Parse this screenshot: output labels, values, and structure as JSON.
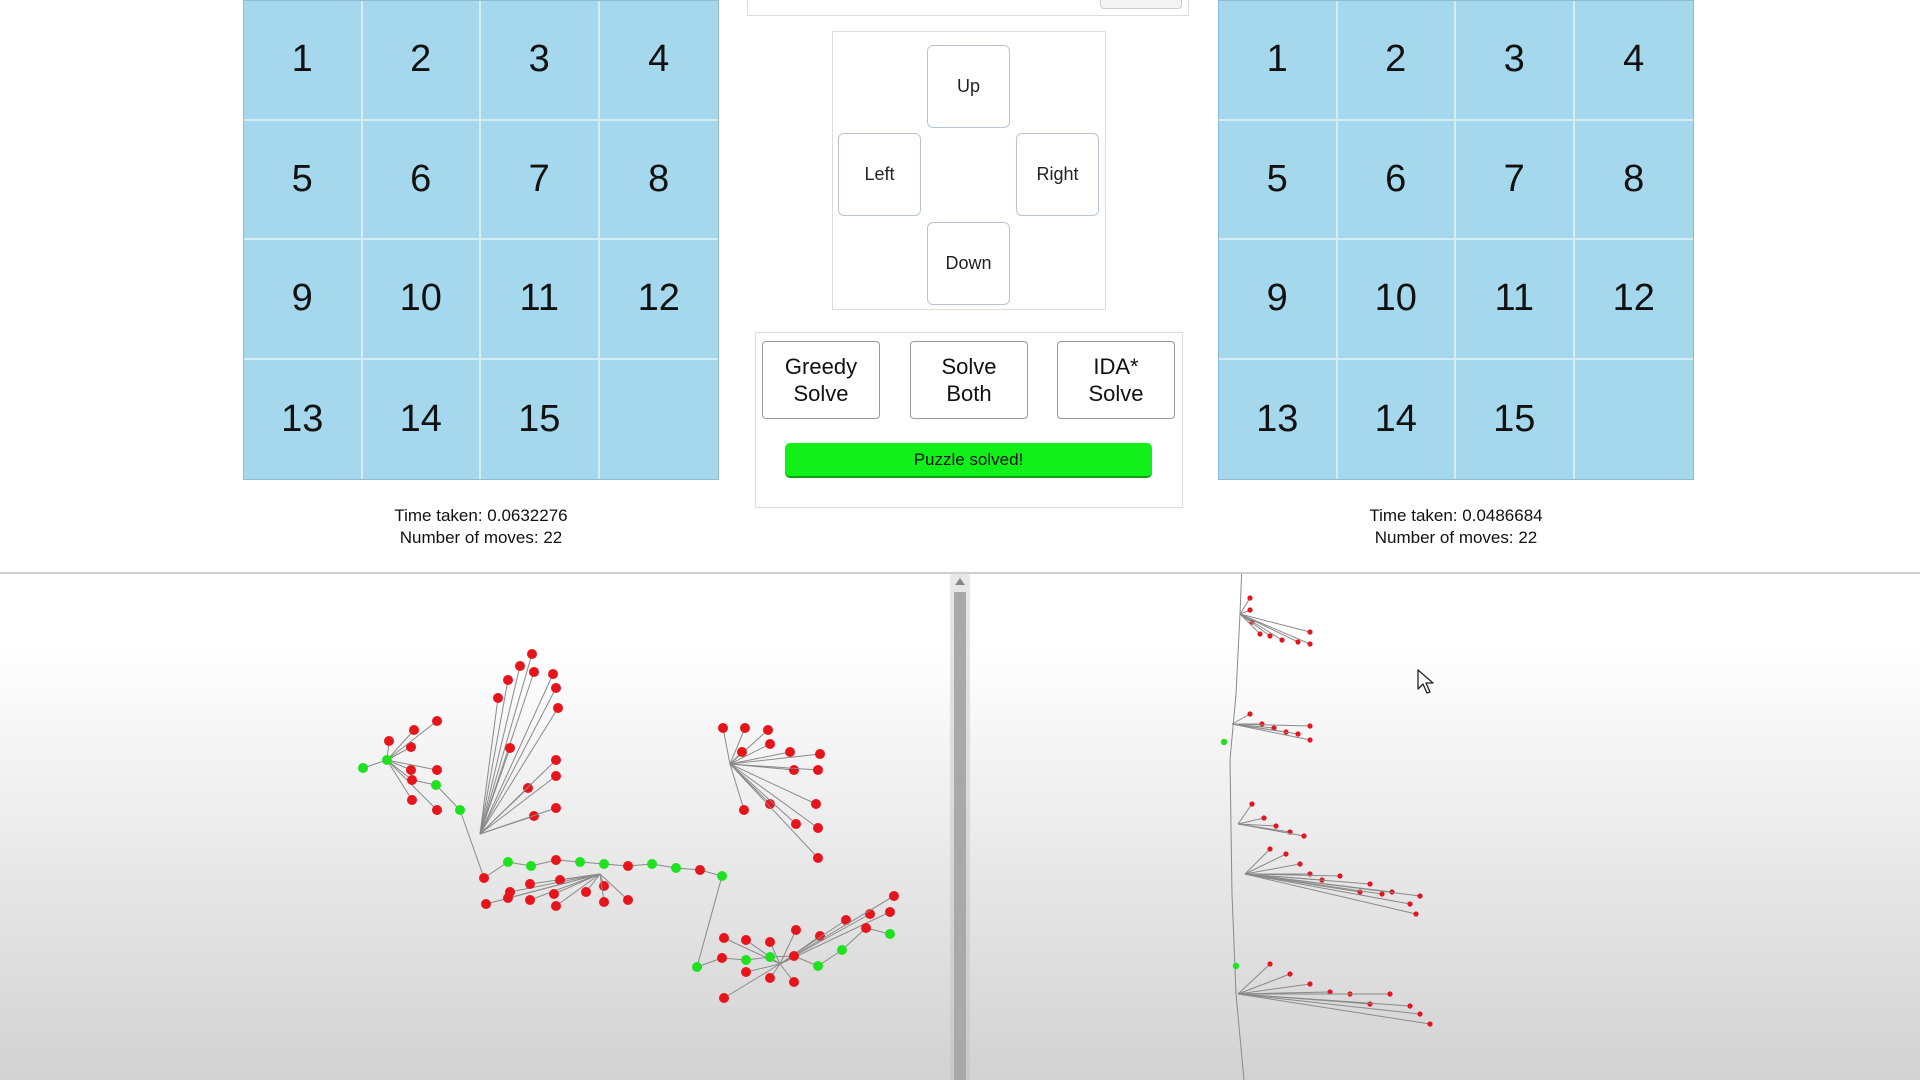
{
  "boards": {
    "left": {
      "tiles": [
        "1",
        "2",
        "3",
        "4",
        "5",
        "6",
        "7",
        "8",
        "9",
        "10",
        "11",
        "12",
        "13",
        "14",
        "15",
        ""
      ]
    },
    "right": {
      "tiles": [
        "1",
        "2",
        "3",
        "4",
        "5",
        "6",
        "7",
        "8",
        "9",
        "10",
        "11",
        "12",
        "13",
        "14",
        "15",
        ""
      ]
    }
  },
  "stats": {
    "left": {
      "time_taken": "Time taken: 0.0632276",
      "moves": "Number of moves: 22"
    },
    "right": {
      "time_taken": "Time taken: 0.0486684",
      "moves": "Number of moves: 22"
    }
  },
  "controls": {
    "up": "Up",
    "left": "Left",
    "right": "Right",
    "down": "Down"
  },
  "solvers": {
    "greedy": "Greedy Solve",
    "both": "Solve Both",
    "ida": "IDA* Solve"
  },
  "status": {
    "message": "Puzzle solved!",
    "color": "#12f01a"
  },
  "colors": {
    "tile_bg": "#a5d8ec",
    "node_explored": "#e8141c",
    "node_path": "#1fe21f",
    "edge": "#8a8a8a"
  },
  "icons": [
    "mouse-pointer-icon",
    "scroll-up-arrow-icon"
  ]
}
